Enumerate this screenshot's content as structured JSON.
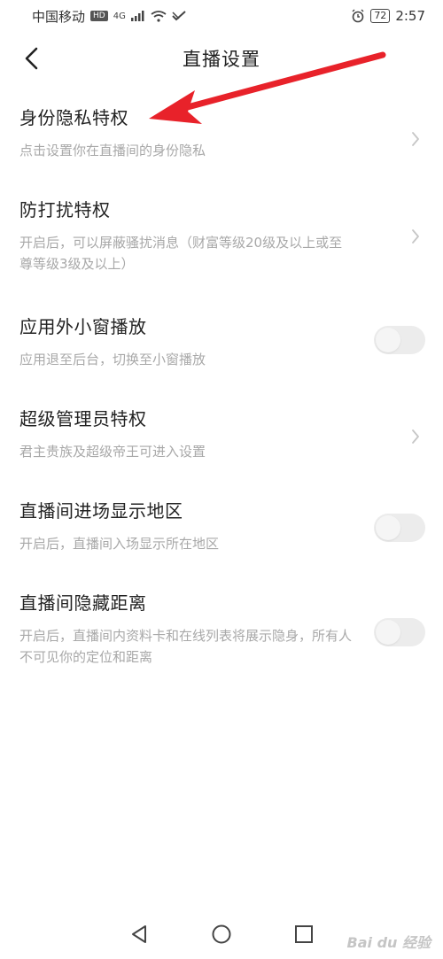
{
  "status_bar": {
    "carrier": "中国移动",
    "hd": "HD",
    "network": "4G",
    "battery": "72",
    "time": "2:57"
  },
  "header": {
    "title": "直播设置"
  },
  "settings": [
    {
      "title": "身份隐私特权",
      "desc": "点击设置你在直播间的身份隐私",
      "control": "chevron"
    },
    {
      "title": "防打扰特权",
      "desc": "开启后，可以屏蔽骚扰消息（财富等级20级及以上或至尊等级3级及以上）",
      "control": "chevron"
    },
    {
      "title": "应用外小窗播放",
      "desc": "应用退至后台，切换至小窗播放",
      "control": "toggle",
      "on": false
    },
    {
      "title": "超级管理员特权",
      "desc": "君主贵族及超级帝王可进入设置",
      "control": "chevron"
    },
    {
      "title": "直播间进场显示地区",
      "desc": "开启后，直播间入场显示所在地区",
      "control": "toggle",
      "on": false
    },
    {
      "title": "直播间隐藏距离",
      "desc": "开启后，直播间内资料卡和在线列表将展示隐身，所有人不可见你的定位和距离",
      "control": "toggle",
      "on": false
    }
  ],
  "icons": {
    "back": "chevron-left-icon",
    "chevron": "chevron-right-icon",
    "nav_back": "triangle-back-icon",
    "nav_home": "circle-home-icon",
    "nav_recent": "square-recent-icon"
  },
  "watermark": "Bai du 经验",
  "colors": {
    "annotation_arrow": "#e8222a",
    "desc_text": "#a8a8a8",
    "toggle_off": "#ececec"
  }
}
